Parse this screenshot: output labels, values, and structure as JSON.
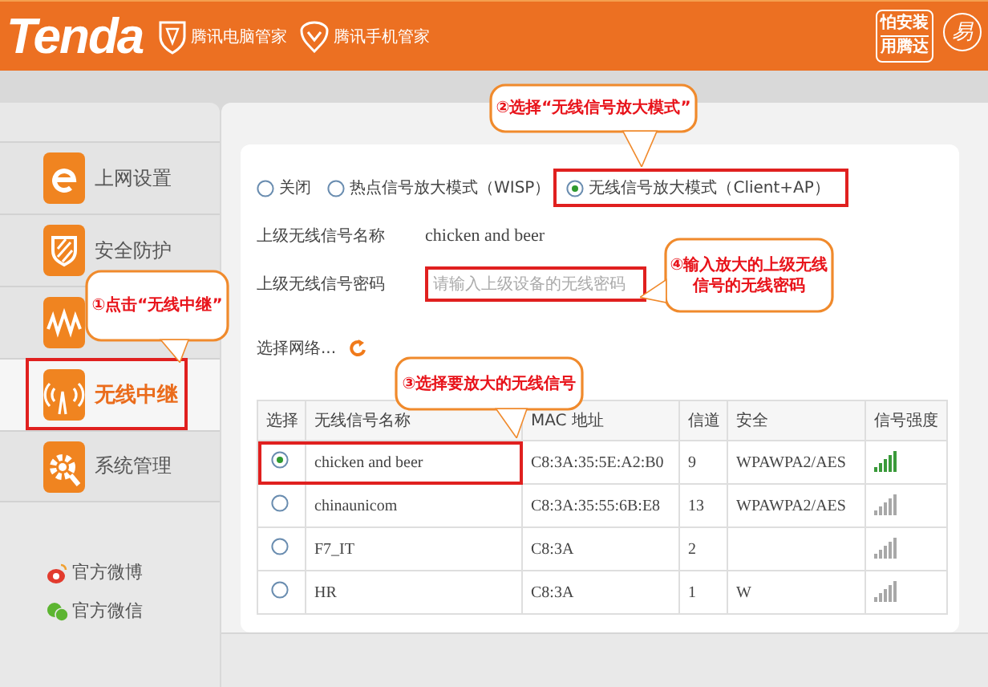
{
  "header": {
    "logo": "Tenda",
    "partners": [
      {
        "label": "腾讯电脑管家"
      },
      {
        "label": "腾讯手机管家"
      }
    ],
    "badge": [
      "怕安装",
      "用腾达"
    ],
    "emblem": "易"
  },
  "sidebar": {
    "items": [
      {
        "label": "上网设置",
        "selected": false
      },
      {
        "label": "安全防护",
        "selected": false
      },
      {
        "selected": false
      },
      {
        "label": "无线中继",
        "selected": true
      },
      {
        "label": "系统管理",
        "selected": false
      }
    ],
    "links": [
      {
        "label": "官方微博"
      },
      {
        "label": "官方微信"
      }
    ]
  },
  "modes": [
    {
      "label": "关闭",
      "selected": false
    },
    {
      "label": "热点信号放大模式（WISP）",
      "selected": false
    },
    {
      "label": "无线信号放大模式（Client+AP）",
      "selected": true
    }
  ],
  "fields": [
    {
      "kind": "text",
      "label": "上级无线信号名称",
      "value": "chicken and beer"
    },
    {
      "kind": "input",
      "label": "上级无线信号密码",
      "placeholder": "请输入上级设备的无线密码"
    }
  ],
  "network_select": {
    "label": "选择网络..."
  },
  "table": {
    "columns": [
      "选择",
      "无线信号名称",
      "MAC 地址",
      "信道",
      "安全",
      "信号强度"
    ],
    "rows": [
      {
        "selected": true,
        "name": "chicken and beer",
        "mac": "C8:3A:35:5E:A2:B0",
        "channel": "9",
        "security": "WPAWPA2/AES"
      },
      {
        "selected": false,
        "name": "chinaunicom",
        "mac": "C8:3A:35:55:6B:E8",
        "channel": "13",
        "security": "WPAWPA2/AES"
      },
      {
        "selected": false,
        "name": "F7_IT",
        "mac": "C8:3A",
        "channel": "2"
      },
      {
        "selected": false,
        "name": "HR",
        "mac": "C8:3A",
        "channel": "1",
        "security": "W"
      }
    ]
  },
  "callouts": [
    {
      "text": "①点击“无线中继”"
    },
    {
      "text": "②选择“无线信号放大模式”"
    },
    {
      "text": "④输入放大的上级无线信号的无线密码"
    },
    {
      "text": "③选择要放大的无线信号"
    }
  ]
}
